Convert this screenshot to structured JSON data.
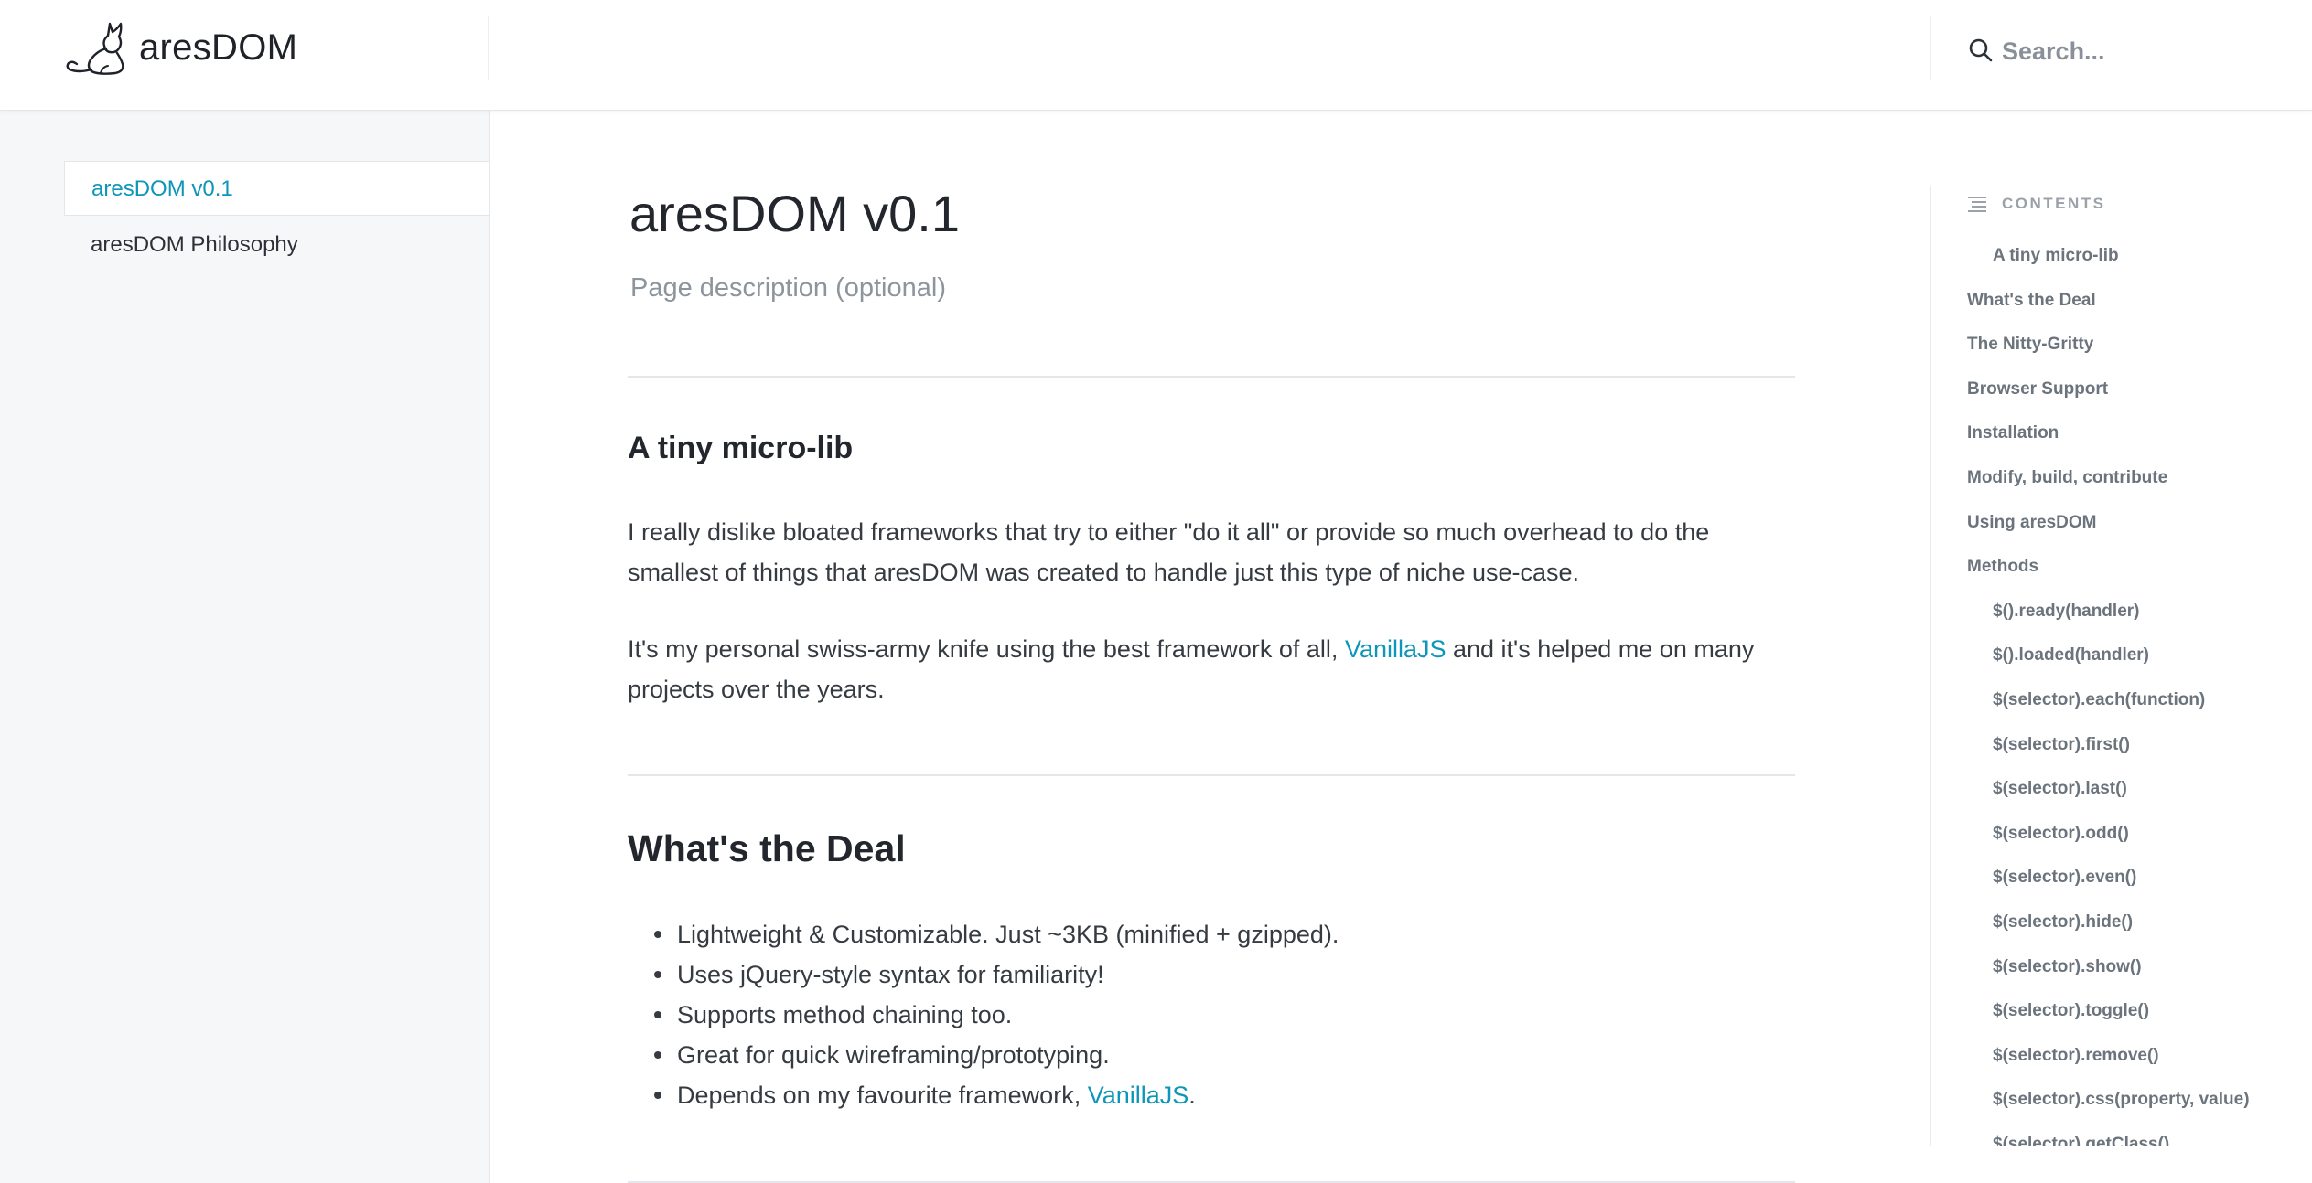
{
  "header": {
    "logo_text": "aresDOM",
    "search_placeholder": "Search..."
  },
  "sidebar": {
    "items": [
      {
        "label": "aresDOM v0.1",
        "active": true
      },
      {
        "label": "aresDOM Philosophy",
        "active": false
      }
    ]
  },
  "main": {
    "title": "aresDOM v0.1",
    "description": "Page description (optional)",
    "sections": [
      {
        "heading": "A tiny micro-lib",
        "paragraph1": "I really dislike bloated frameworks that try to either \"do it all\" or provide so much overhead to do the smallest of things that aresDOM was created to handle just this type of niche use-case.",
        "paragraph2_before": "It's my personal swiss-army knife using the best framework of all, ",
        "paragraph2_link": "VanillaJS",
        "paragraph2_after": " and it's helped me on many projects over the years."
      },
      {
        "heading": "What's the Deal",
        "bullets": [
          "Lightweight & Customizable. Just ~3KB (minified + gzipped).",
          "Uses jQuery-style syntax for familiarity!",
          "Supports method chaining too.",
          "Great for quick wireframing/prototyping."
        ],
        "last_bullet_before": "Depends on my favourite framework, ",
        "last_bullet_link": "VanillaJS",
        "last_bullet_after": "."
      }
    ]
  },
  "toc": {
    "heading": "CONTENTS",
    "items": [
      {
        "label": "A tiny micro-lib",
        "level": 2
      },
      {
        "label": "What's the Deal",
        "level": 1
      },
      {
        "label": "The Nitty-Gritty",
        "level": 1
      },
      {
        "label": "Browser Support",
        "level": 1
      },
      {
        "label": "Installation",
        "level": 1
      },
      {
        "label": "Modify, build, contribute",
        "level": 1
      },
      {
        "label": "Using aresDOM",
        "level": 1
      },
      {
        "label": "Methods",
        "level": 1
      },
      {
        "label": "$().ready(handler)",
        "level": 2
      },
      {
        "label": "$().loaded(handler)",
        "level": 2
      },
      {
        "label": "$(selector).each(function)",
        "level": 2
      },
      {
        "label": "$(selector).first()",
        "level": 2
      },
      {
        "label": "$(selector).last()",
        "level": 2
      },
      {
        "label": "$(selector).odd()",
        "level": 2
      },
      {
        "label": "$(selector).even()",
        "level": 2
      },
      {
        "label": "$(selector).hide()",
        "level": 2
      },
      {
        "label": "$(selector).show()",
        "level": 2
      },
      {
        "label": "$(selector).toggle()",
        "level": 2
      },
      {
        "label": "$(selector).remove()",
        "level": 2
      },
      {
        "label": "$(selector).css(property, value)",
        "level": 2
      },
      {
        "label": "$(selector).getClass()",
        "level": 2
      }
    ]
  },
  "colors": {
    "accent": "#0d96b8",
    "sidebar_bg": "#f6f7f9",
    "text": "#363b42",
    "muted": "#8d949c"
  },
  "icons": [
    "cat-logo-icon",
    "search-icon",
    "contents-list-icon"
  ]
}
